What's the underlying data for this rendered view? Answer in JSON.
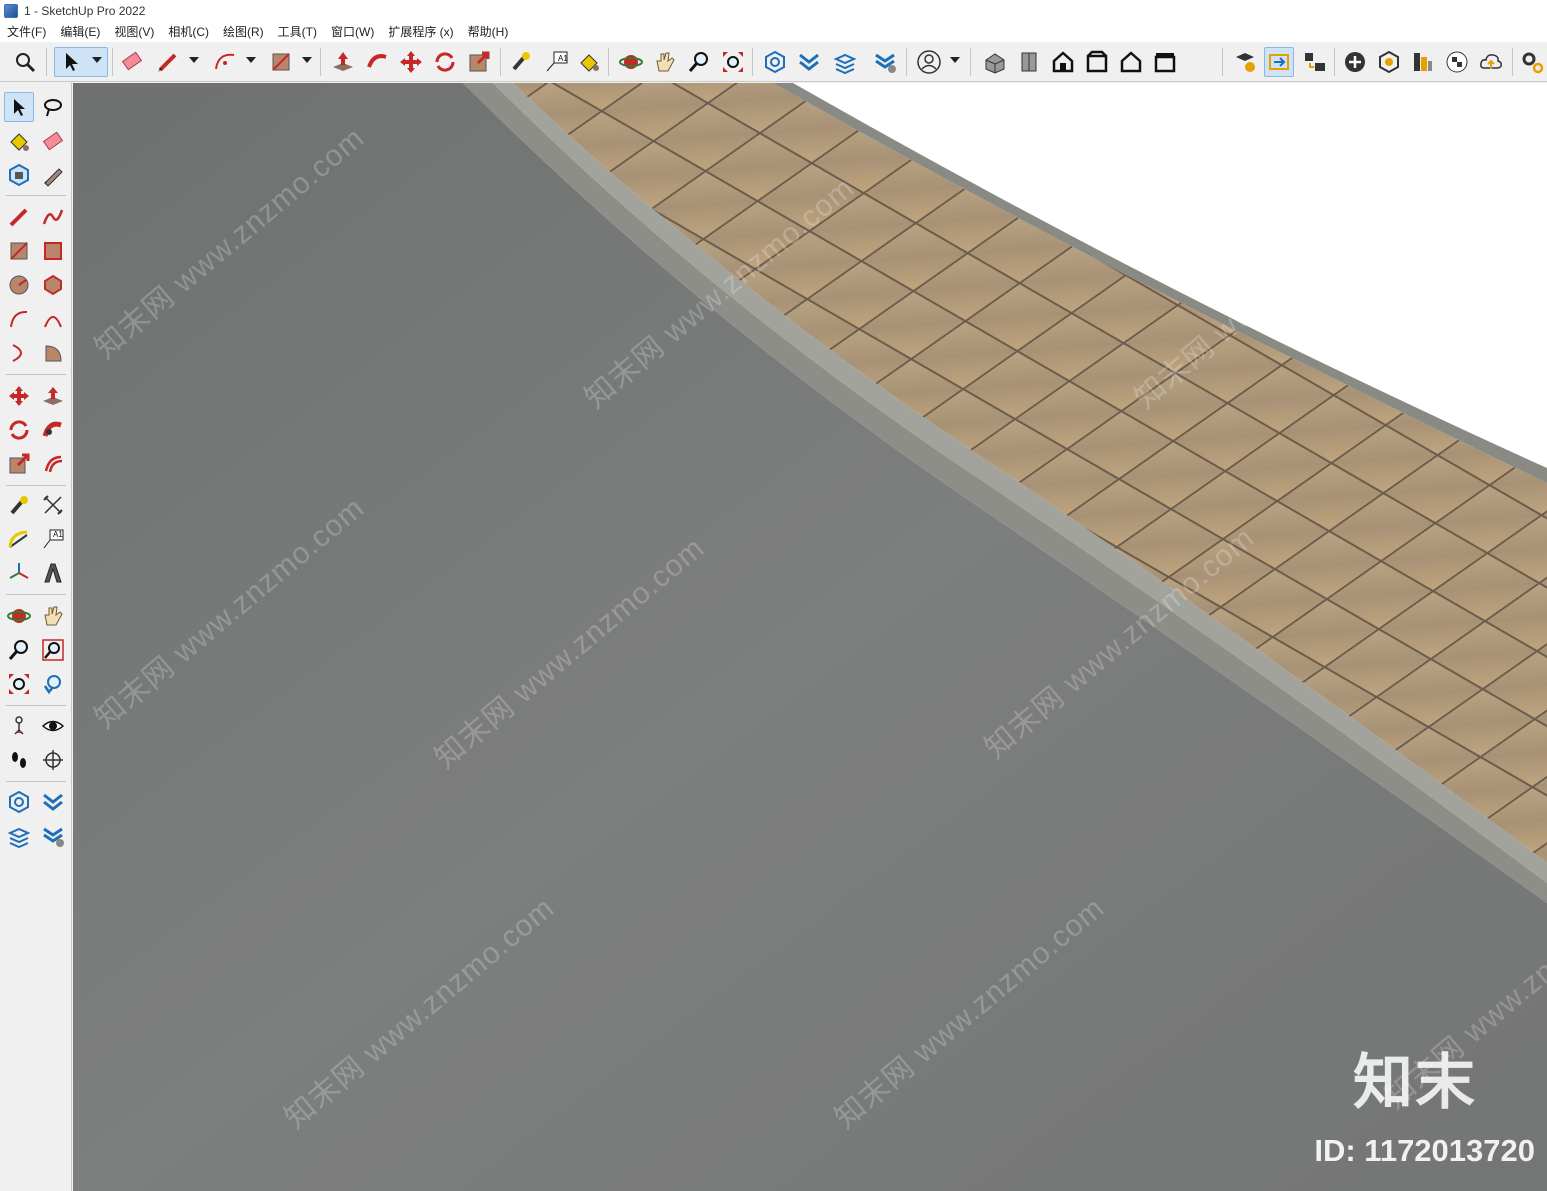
{
  "window": {
    "title": "1 - SketchUp Pro 2022"
  },
  "menu": [
    "文件(F)",
    "编辑(E)",
    "视图(V)",
    "相机(C)",
    "绘图(R)",
    "工具(T)",
    "窗口(W)",
    "扩展程序 (x)",
    "帮助(H)"
  ],
  "toolbar": {
    "text_tool_label": "A1"
  },
  "left_toolbar": {
    "text_tool_label": "A1"
  },
  "viewport": {
    "watermark_text": "知末网 www.znzmo.com",
    "brand_logo": "知末",
    "brand_id": "ID: 1172013720"
  },
  "colors": {
    "ground": "#7a7b7b",
    "curb": "#8c8c86",
    "tiles": "#b59f7e",
    "sky": "#ffffff",
    "accent_red": "#d32f2f",
    "accent_blue": "#1e6fb8"
  }
}
